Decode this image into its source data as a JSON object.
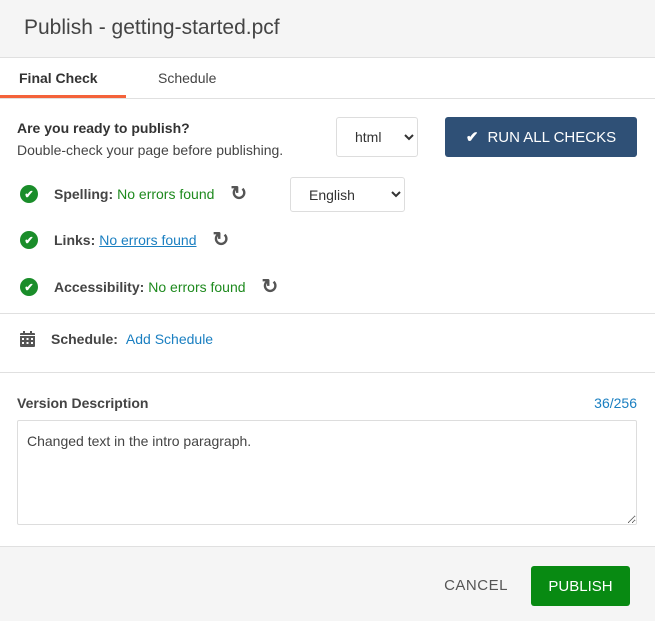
{
  "header": {
    "title": "Publish - getting-started.pcf"
  },
  "tabs": [
    {
      "label": "Final Check",
      "active": true
    },
    {
      "label": "Schedule",
      "active": false
    }
  ],
  "final_check": {
    "ready_title": "Are you ready to publish?",
    "ready_subtitle": "Double-check your page before publishing.",
    "format_select": {
      "value": "html",
      "options": [
        "html"
      ]
    },
    "run_all_label": "RUN ALL CHECKS",
    "checks": [
      {
        "label": "Spelling:",
        "status": "No errors found",
        "status_style": "text"
      },
      {
        "label": "Links:",
        "status": "No errors found",
        "status_style": "link"
      },
      {
        "label": "Accessibility:",
        "status": "No errors found",
        "status_style": "text"
      }
    ],
    "language_select": {
      "value": "English",
      "options": [
        "English"
      ]
    }
  },
  "schedule": {
    "label": "Schedule:",
    "action": "Add Schedule"
  },
  "version_description": {
    "label": "Version Description",
    "count": "36/256",
    "value": "Changed text in the intro paragraph."
  },
  "footer": {
    "cancel_label": "CANCEL",
    "publish_label": "PUBLISH"
  },
  "colors": {
    "tab_accent": "#f4623a",
    "primary_button": "#2f5076",
    "success": "#1a8d2a",
    "link": "#1a7fc1",
    "publish_button": "#088a12"
  }
}
